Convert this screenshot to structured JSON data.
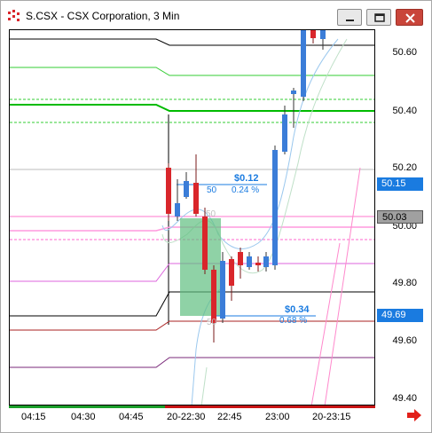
{
  "window": {
    "title": "S.CSX - CSX Corporation, 3 Min"
  },
  "chart": {
    "symbol": "S.CSX",
    "company": "CSX Corporation",
    "interval": "3 Min",
    "annotations": {
      "upper_label_value": "$0.12",
      "upper_label_count": "50",
      "upper_label_pct": "0.24 %",
      "lower_label_value": "$0.34",
      "lower_label_pct": "0.68 %",
      "ghost_upper": "50",
      "ghost_lower": "50"
    },
    "colors": {
      "bull_candle": "#3b7dd8",
      "bear_candle": "#d9262b",
      "highlight_box": "#5fbf80",
      "blue_box": "#1a7be0",
      "last_price_box": "#1a7be0",
      "cursor_box": "#9a9a9a"
    }
  },
  "price_axis": {
    "labels": [
      "50.60",
      "50.40",
      "50.20",
      "50.00",
      "49.80",
      "49.60",
      "49.40"
    ],
    "last_price": "50.15",
    "cursor_price": "50.03",
    "marker_price": "49.69"
  },
  "time_axis": {
    "labels": [
      "04:15",
      "04:30",
      "04:45",
      "20-22:30",
      "22:45",
      "23:00",
      "20-23:15"
    ]
  }
}
